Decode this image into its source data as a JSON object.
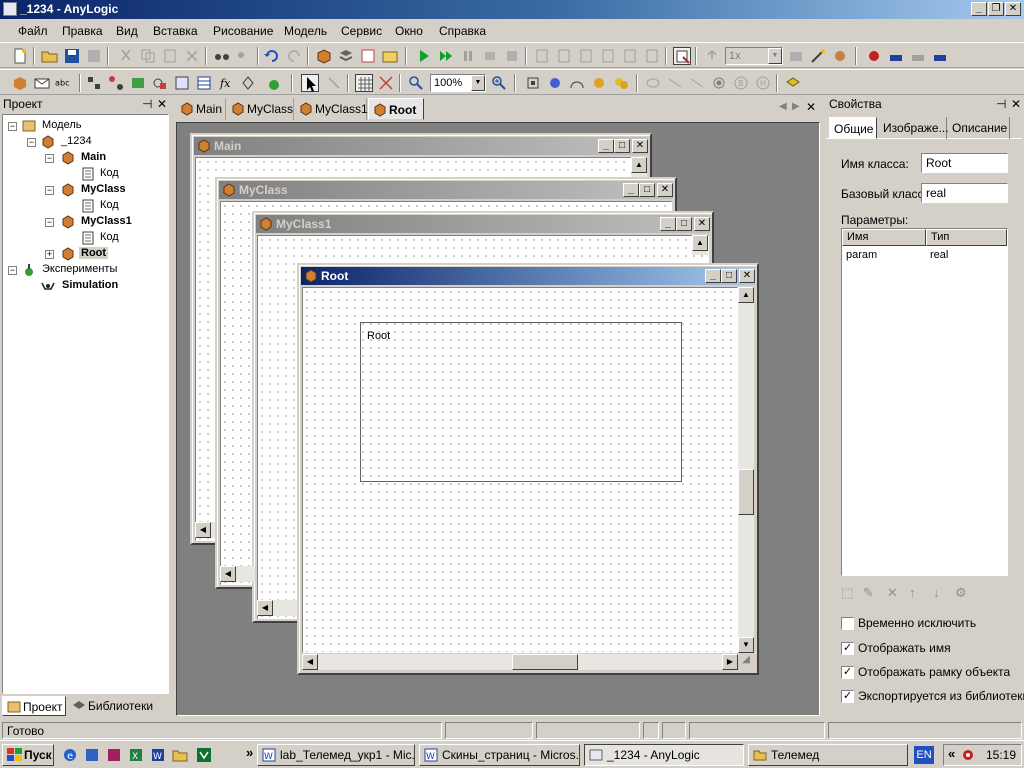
{
  "window": {
    "title": "_1234 - AnyLogic"
  },
  "menu": [
    "Файл",
    "Правка",
    "Вид",
    "Вставка",
    "Рисование",
    "Модель",
    "Сервис",
    "Окно",
    "Справка"
  ],
  "toolbar": {
    "speed_value": "1x",
    "zoom_value": "100%"
  },
  "project_panel": {
    "title": "Проект",
    "tree": [
      {
        "label": "Модель",
        "bold": false
      },
      {
        "label": "_1234",
        "bold": false
      },
      {
        "label": "Main",
        "bold": true
      },
      {
        "label": "Код",
        "bold": false
      },
      {
        "label": "MyClass",
        "bold": true
      },
      {
        "label": "Код",
        "bold": false
      },
      {
        "label": "MyClass1",
        "bold": true
      },
      {
        "label": "Код",
        "bold": false
      },
      {
        "label": "Root",
        "bold": true
      },
      {
        "label": "Эксперименты",
        "bold": false
      },
      {
        "label": "Simulation",
        "bold": true
      }
    ],
    "tabs": [
      "Проект",
      "Библиотеки"
    ]
  },
  "doc_tabs": [
    "Main",
    "MyClass",
    "MyClass1",
    "Root"
  ],
  "windows": {
    "main": {
      "title": "Main"
    },
    "myclass": {
      "title": "MyClass"
    },
    "myclass1": {
      "title": "MyClass1"
    },
    "root": {
      "title": "Root",
      "frame_label": "Root"
    }
  },
  "properties": {
    "title": "Свойства",
    "tabs": [
      "Общие",
      "Изображе...",
      "Описание"
    ],
    "class_name_label": "Имя класса:",
    "class_name_value": "Root",
    "base_class_label": "Базовый класс:",
    "base_class_value": "real",
    "params_label": "Параметры:",
    "params_columns": [
      "Имя",
      "Тип"
    ],
    "params_rows": [
      {
        "name": "param",
        "type": "real"
      }
    ],
    "checkboxes": [
      {
        "label": "Временно исключить",
        "checked": false
      },
      {
        "label": "Отображать имя",
        "checked": true
      },
      {
        "label": "Отображать рамку объекта",
        "checked": true
      },
      {
        "label": "Экспортируется из библиотеки",
        "checked": true
      }
    ]
  },
  "status": {
    "text": "Готово"
  },
  "taskbar": {
    "start_label": "Пуск",
    "tasks": [
      {
        "label": "lab_Телемед_укр1 - Mic..."
      },
      {
        "label": "Скины_страниц - Micros..."
      },
      {
        "label": "_1234 - AnyLogic"
      },
      {
        "label": "Телемед"
      }
    ],
    "lang": "EN",
    "tray_chevron": "«",
    "quicklaunch_chevron": "»",
    "clock": "15:19"
  },
  "colors": {
    "active_caption": "#0a246a",
    "inactive_caption": "#808080",
    "face": "#d4d0c8",
    "workspace": "#808080"
  }
}
